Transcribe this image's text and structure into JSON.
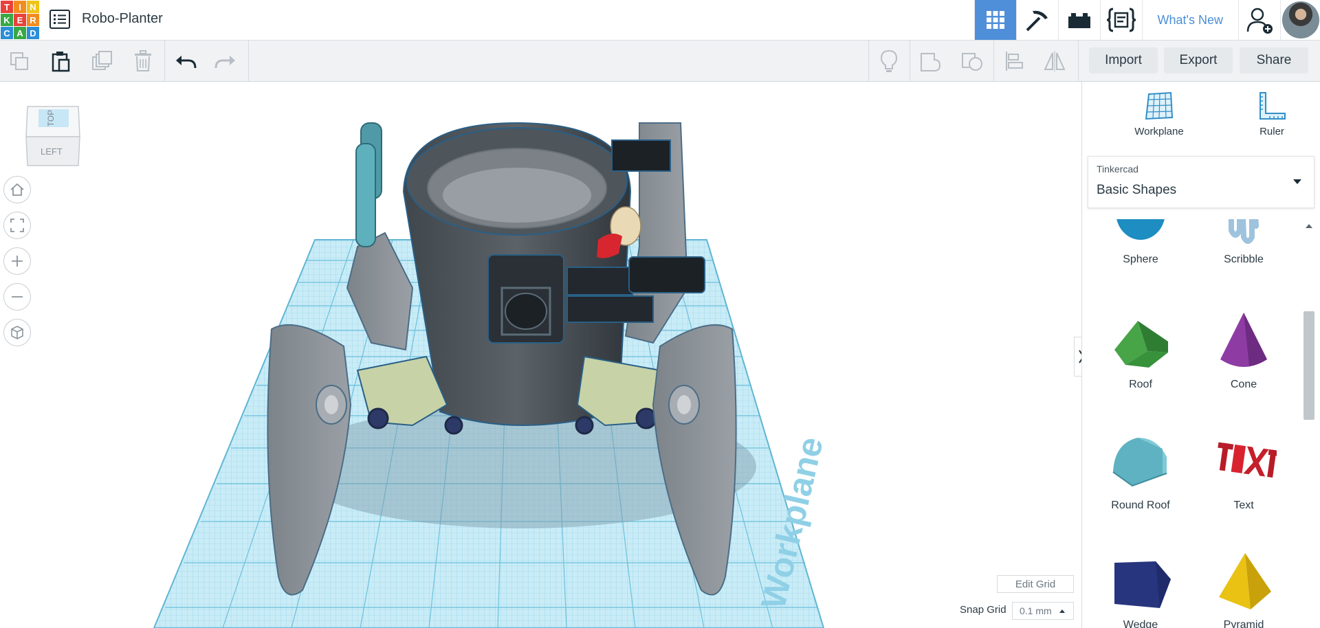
{
  "app": {
    "logo_letters": [
      "T",
      "I",
      "N",
      "K",
      "E",
      "R",
      "C",
      "A",
      "D"
    ],
    "logo_colors": [
      "#e8423b",
      "#f38c1e",
      "#f1c314",
      "#37a845",
      "#e8423b",
      "#f38c1e",
      "#2b8ed6",
      "#37a845",
      "#2b8ed6"
    ],
    "project_title": "Robo-Planter",
    "whats_new": "What's New",
    "accent_color": "#4f8fd9"
  },
  "top_icons": [
    "grid-view-icon",
    "pickaxe-icon",
    "bricks-icon",
    "code-blocks-icon",
    "add-user-icon"
  ],
  "toolbar": {
    "import_label": "Import",
    "export_label": "Export",
    "share_label": "Share"
  },
  "viewcube": {
    "top_label": "TOP",
    "front_label": "LEFT"
  },
  "workplane_label": "Workplane",
  "grid": {
    "edit_label": "Edit Grid",
    "snap_label": "Snap Grid",
    "snap_value": "0.1 mm"
  },
  "panel": {
    "workplane_label": "Workplane",
    "ruler_label": "Ruler",
    "library_source": "Tinkercad",
    "library_value": "Basic Shapes",
    "shapes": [
      {
        "label": "Sphere"
      },
      {
        "label": "Scribble"
      },
      {
        "label": "Roof"
      },
      {
        "label": "Cone"
      },
      {
        "label": "Round Roof"
      },
      {
        "label": "Text"
      },
      {
        "label": "Wedge"
      },
      {
        "label": "Pyramid"
      }
    ]
  }
}
